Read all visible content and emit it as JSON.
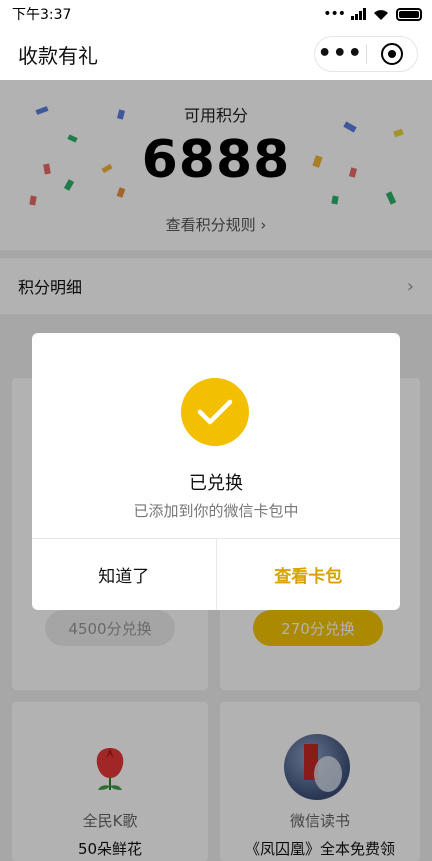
{
  "status_bar": {
    "time": "下午3:37"
  },
  "nav": {
    "title": "收款有礼"
  },
  "points": {
    "label": "可用积分",
    "value": "6888",
    "rules_link": "查看积分规则 ›"
  },
  "detail": {
    "label": "积分明细"
  },
  "rewards": [
    {
      "button": "4500分兑换"
    },
    {
      "button": "270分兑换"
    }
  ],
  "products": [
    {
      "brand": "全民K歌",
      "name": "50朵鲜花"
    },
    {
      "brand": "微信读书",
      "name": "《凤囚凰》全本免费领"
    }
  ],
  "modal": {
    "title": "已兑换",
    "subtitle": "已添加到你的微信卡包中",
    "cancel": "知道了",
    "confirm": "查看卡包",
    "accent": "#f2c000"
  }
}
